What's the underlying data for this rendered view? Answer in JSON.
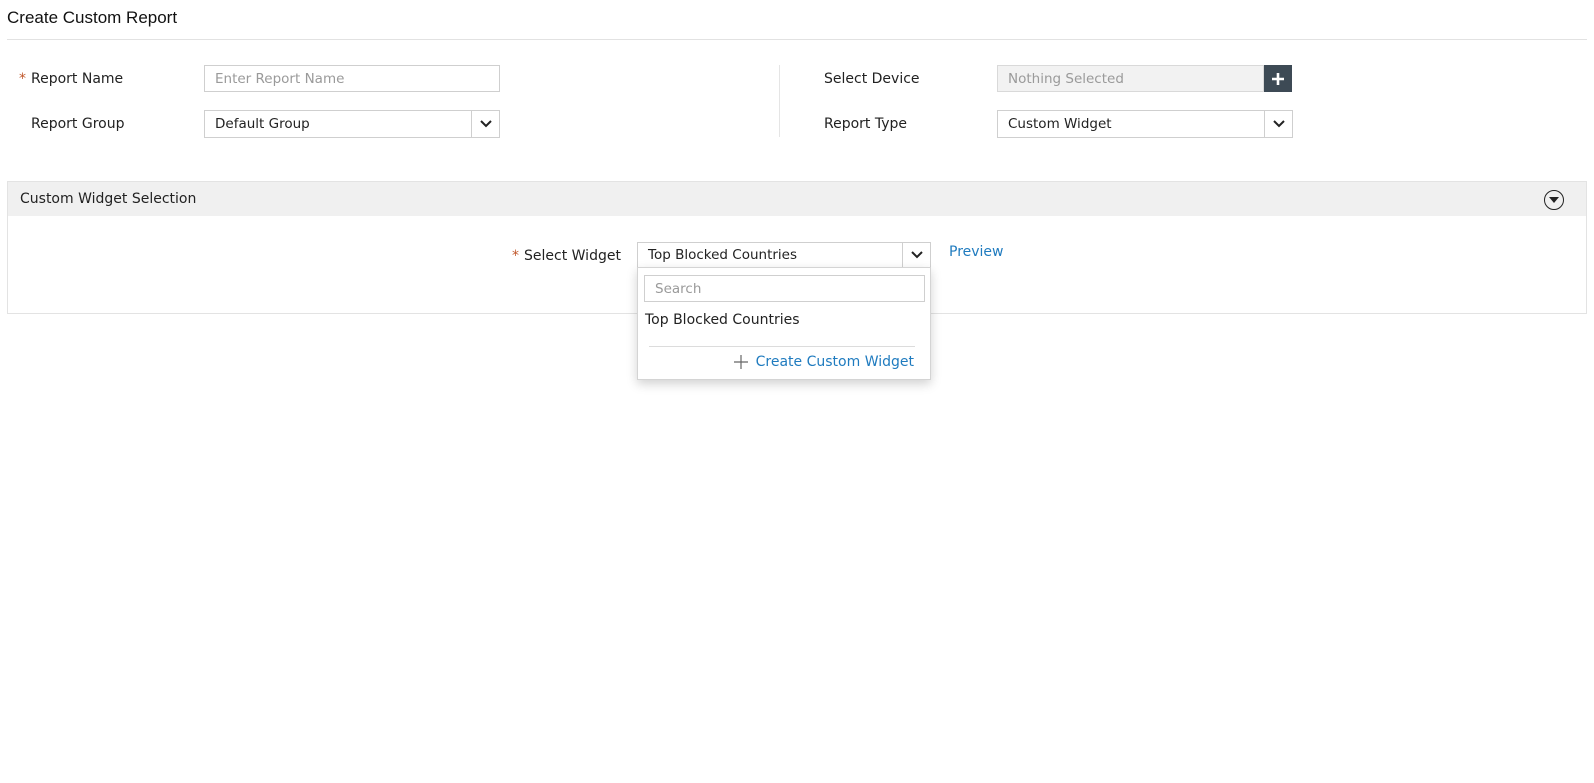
{
  "page": {
    "title": "Create Custom Report"
  },
  "form": {
    "report_name": {
      "label": "Report Name",
      "required_mark": "*",
      "placeholder": "Enter Report Name",
      "value": ""
    },
    "report_group": {
      "label": "Report Group",
      "value": "Default Group"
    },
    "select_device": {
      "label": "Select Device",
      "value": "Nothing Selected",
      "add_icon": "plus-icon"
    },
    "report_type": {
      "label": "Report Type",
      "value": "Custom Widget"
    }
  },
  "panel": {
    "title": "Custom Widget Selection",
    "collapse_icon": "circle-chevron-down-icon",
    "select_widget": {
      "label": "Select Widget",
      "required_mark": "*",
      "value": "Top Blocked Countries"
    },
    "preview_label": "Preview"
  },
  "dropdown": {
    "search_placeholder": "Search",
    "options": [
      "Top Blocked Countries"
    ],
    "create_label": "Create Custom Widget",
    "create_icon": "plus-icon"
  },
  "colors": {
    "accent_link": "#1f7bbf",
    "required": "#c0572b",
    "add_button": "#3d4a55",
    "panel_header_bg": "#f0f0f0"
  }
}
